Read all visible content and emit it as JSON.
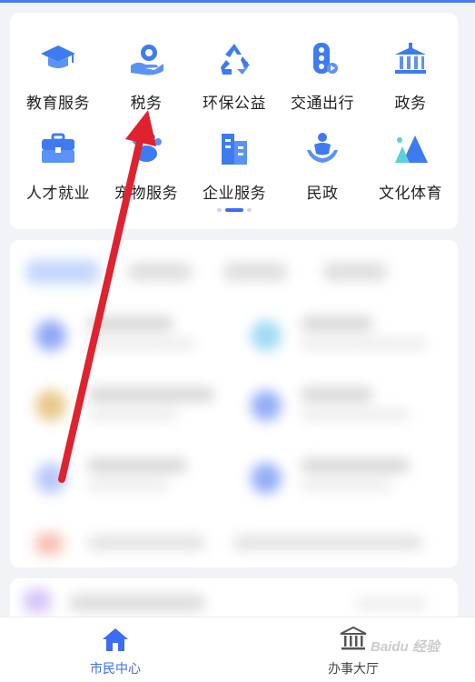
{
  "services": [
    {
      "label": "教育服务",
      "icon": "graduation-cap-icon"
    },
    {
      "label": "税务",
      "icon": "tax-hand-icon"
    },
    {
      "label": "环保公益",
      "icon": "recycle-icon"
    },
    {
      "label": "交通出行",
      "icon": "traffic-light-icon"
    },
    {
      "label": "政务",
      "icon": "government-building-icon"
    },
    {
      "label": "人才就业",
      "icon": "briefcase-icon"
    },
    {
      "label": "宠物服务",
      "icon": "pet-icon"
    },
    {
      "label": "企业服务",
      "icon": "office-building-icon"
    },
    {
      "label": "民政",
      "icon": "civil-affairs-icon"
    },
    {
      "label": "文化体育",
      "icon": "mountain-flag-icon"
    }
  ],
  "pager": {
    "pages": 3,
    "active": 1
  },
  "tabbar": {
    "home_label": "市民中心",
    "hall_label": "办事大厅"
  },
  "watermark": "Baidu 经验",
  "colors": {
    "accent": "#3d6cf2",
    "annotation_arrow": "#e0222f",
    "icon_blue": "#3f7bf0"
  }
}
